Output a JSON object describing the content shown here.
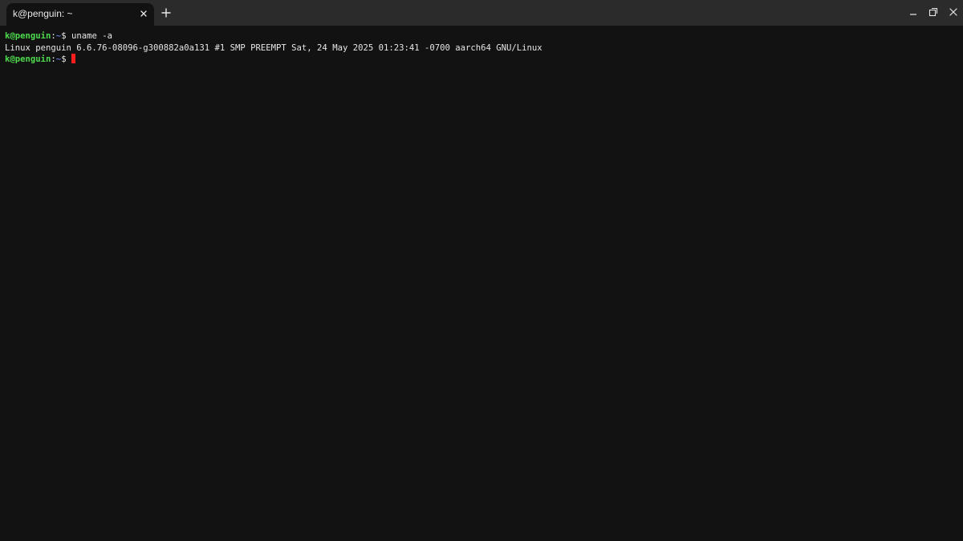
{
  "window": {
    "tab_title": "k@penguin: ~",
    "icons": {
      "tab_close": "close-icon",
      "new_tab": "plus-icon",
      "minimize": "minimize-icon",
      "restore": "restore-icon",
      "close": "close-icon"
    }
  },
  "terminal": {
    "lines": [
      {
        "user": "k@penguin",
        "separator": ":",
        "path": "~",
        "prompt": "$",
        "command": " uname -a"
      },
      {
        "output": "Linux penguin 6.6.76-08096-g300882a0a131 #1 SMP PREEMPT Sat, 24 May 2025 01:23:41 -0700 aarch64 GNU/Linux"
      },
      {
        "user": "k@penguin",
        "separator": ":",
        "path": "~",
        "prompt": "$"
      }
    ]
  },
  "colors": {
    "background": "#121212",
    "titlebar": "#2b2b2b",
    "prompt_user": "#4cd94c",
    "prompt_path": "#6f8fff",
    "cursor": "#ff1d1d",
    "text": "#e6e6e6"
  }
}
